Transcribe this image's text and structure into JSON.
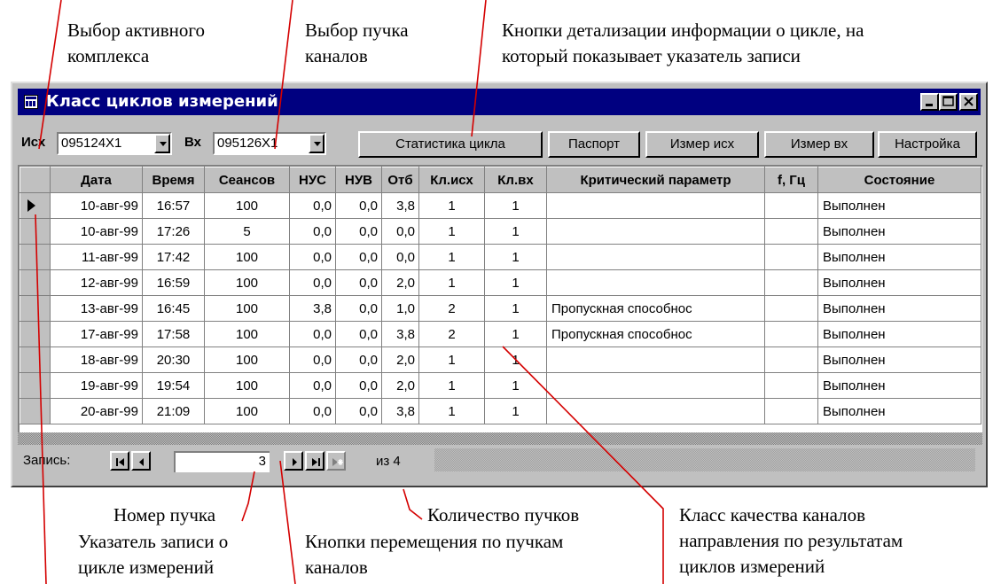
{
  "annotations": {
    "active_complex": [
      "Выбор активного",
      "комплекса"
    ],
    "bundle_select": [
      "Выбор пучка",
      "каналов"
    ],
    "detail_buttons": [
      "Кнопки детализации информации о цикле, на",
      "который показывает указатель записи"
    ],
    "bundle_number": "Номер пучка",
    "bundle_count": "Количество пучков",
    "quality_class": [
      "Класс качества каналов",
      "направления по результатам",
      "циклов измерений"
    ],
    "record_pointer": [
      "Указатель записи о",
      "цикле измерений"
    ],
    "nav_buttons": [
      "Кнопки перемещения по пучкам",
      "каналов"
    ]
  },
  "window": {
    "title": "Класс циклов измерений"
  },
  "toolbar": {
    "out_label": "Исх",
    "out_value": "095124X1",
    "in_label": "Вх",
    "in_value": "095126X1",
    "buttons": [
      "Статистика цикла",
      "Паспорт",
      "Измер исх",
      "Измер вх",
      "Настройка"
    ]
  },
  "table": {
    "headers": [
      "Дата",
      "Время",
      "Сеансов",
      "НУС",
      "НУВ",
      "Отб",
      "Кл.исх",
      "Кл.вх",
      "Критический параметр",
      "f, Гц",
      "Состояние"
    ],
    "rows": [
      [
        "10-авг-99",
        "16:57",
        "100",
        "0,0",
        "0,0",
        "3,8",
        "1",
        "1",
        "",
        "",
        "Выполнен"
      ],
      [
        "10-авг-99",
        "17:26",
        "5",
        "0,0",
        "0,0",
        "0,0",
        "1",
        "1",
        "",
        "",
        "Выполнен"
      ],
      [
        "11-авг-99",
        "17:42",
        "100",
        "0,0",
        "0,0",
        "0,0",
        "1",
        "1",
        "",
        "",
        "Выполнен"
      ],
      [
        "12-авг-99",
        "16:59",
        "100",
        "0,0",
        "0,0",
        "2,0",
        "1",
        "1",
        "",
        "",
        "Выполнен"
      ],
      [
        "13-авг-99",
        "16:45",
        "100",
        "3,8",
        "0,0",
        "1,0",
        "2",
        "1",
        "Пропускная способнос",
        "",
        "Выполнен"
      ],
      [
        "17-авг-99",
        "17:58",
        "100",
        "0,0",
        "0,0",
        "3,8",
        "2",
        "1",
        "Пропускная способнос",
        "",
        "Выполнен"
      ],
      [
        "18-авг-99",
        "20:30",
        "100",
        "0,0",
        "0,0",
        "2,0",
        "1",
        "1",
        "",
        "",
        "Выполнен"
      ],
      [
        "19-авг-99",
        "19:54",
        "100",
        "0,0",
        "0,0",
        "2,0",
        "1",
        "1",
        "",
        "",
        "Выполнен"
      ],
      [
        "20-авг-99",
        "21:09",
        "100",
        "0,0",
        "0,0",
        "3,8",
        "1",
        "1",
        "",
        "",
        "Выполнен"
      ]
    ]
  },
  "navigator": {
    "label": "Запись:",
    "record": "3",
    "of_text": "из 4"
  }
}
